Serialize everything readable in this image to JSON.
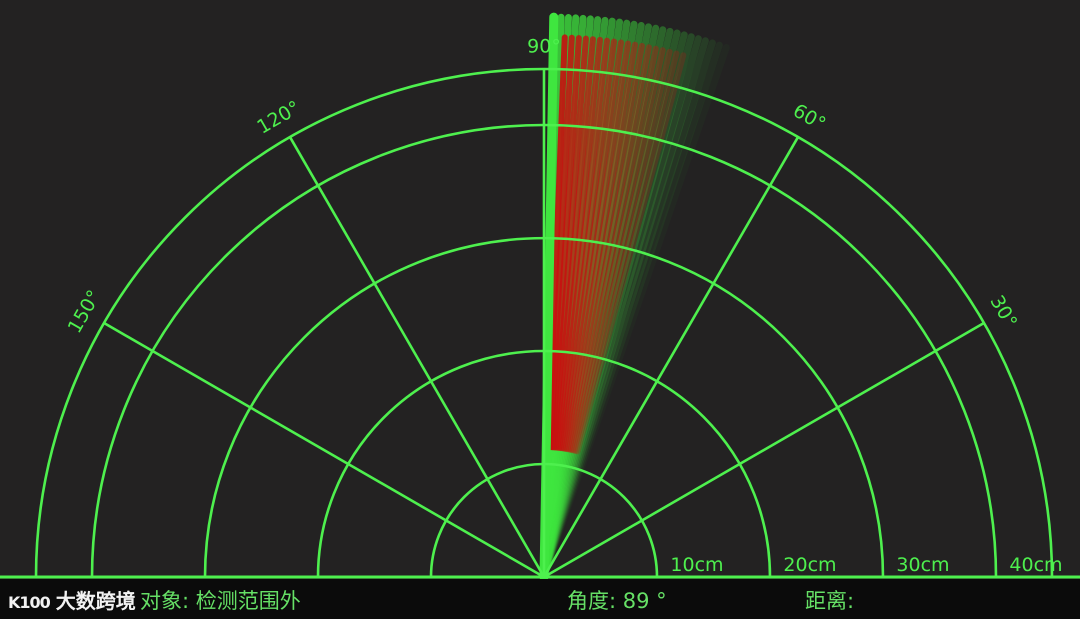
{
  "radar": {
    "angle_labels": [
      "30°",
      "60°",
      "90°",
      "120°",
      "150°"
    ],
    "distance_labels": [
      "10cm",
      "20cm",
      "30cm",
      "40cm"
    ],
    "sweep_angle_deg": 89,
    "colors": {
      "grid": "#4ef04e",
      "background": "#232222",
      "sweep": "#3fe63f",
      "object": "#c81010"
    }
  },
  "status": {
    "object_text": "对象: 检测范围外",
    "angle_text": "角度: 89 °",
    "distance_text": "距离:"
  },
  "watermark": {
    "logo": "K100",
    "text": "大数跨境"
  }
}
